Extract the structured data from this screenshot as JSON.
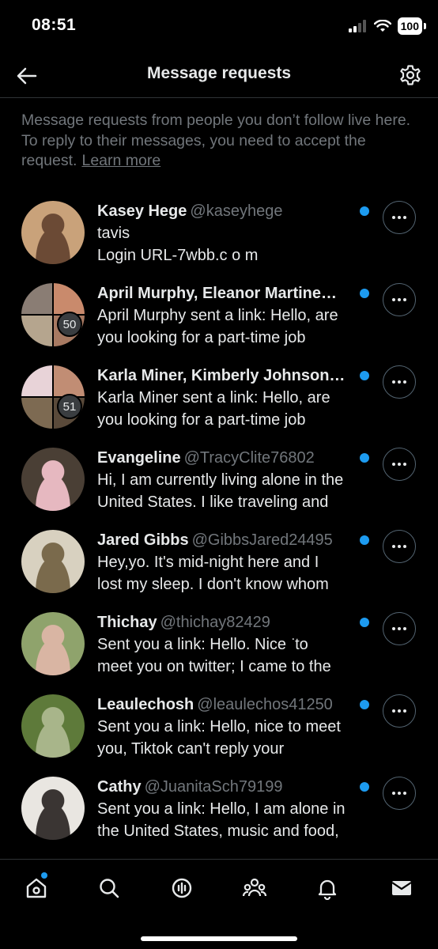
{
  "status_bar": {
    "time": "08:51",
    "battery": "100"
  },
  "header": {
    "title": "Message requests"
  },
  "info": {
    "text": "Message requests from people you don’t follow live here. To reply to their messages, you need to accept the request.",
    "link": "Learn more"
  },
  "requests": [
    {
      "name": "Kasey Hege",
      "handle": "@kaseyhege",
      "lines": [
        "tavis",
        "Login URL-7wbb.c o m"
      ],
      "avatar_colors": [
        "#c9a27a",
        "#6b4a35"
      ]
    },
    {
      "name": "April Murphy, Eleanor Martine…",
      "handle": "",
      "lines": [
        "April Murphy sent a link: Hello, are",
        "you looking for a part-time job"
      ],
      "group_count": "50",
      "avatar_colors": [
        "#8a7d74",
        "#c98a6c",
        "#b5a58e",
        "#a87a62"
      ]
    },
    {
      "name": "Karla Miner, Kimberly Johnson…",
      "handle": "",
      "lines": [
        "Karla Miner sent a link: Hello, are",
        "you looking for a part-time job"
      ],
      "group_count": "51",
      "avatar_colors": [
        "#e8d3d8",
        "#c18d74",
        "#7d6a52",
        "#5a4a3a"
      ]
    },
    {
      "name": "Evangeline",
      "handle": "@TracyClite76802",
      "lines": [
        "Hi, I am currently living alone in the",
        "United States. I like traveling and"
      ],
      "avatar_colors": [
        "#4a3f35",
        "#e6b8c0"
      ]
    },
    {
      "name": "Jared Gibbs",
      "handle": "@GibbsJared24495",
      "lines": [
        "Hey,yo. It's mid-night here and I",
        "lost my sleep. I don't know whom"
      ],
      "avatar_colors": [
        "#d8d1c0",
        "#7a6a4c"
      ]
    },
    {
      "name": "Thichay",
      "handle": "@thichay82429",
      "lines": [
        "Sent you a link: Hello. Nice ͘ to",
        "meet you on twitter; I came ͏to ͘the"
      ],
      "avatar_colors": [
        "#8fa36c",
        "#d9b5a3"
      ]
    },
    {
      "name": "Leaulechosh",
      "handle": "@leaulechos41250",
      "lines": [
        "Sent you a link: Hello, nice to meet",
        "you, Tiktok can't reply your"
      ],
      "avatar_colors": [
        "#5e7a3a",
        "#a8b58a"
      ]
    },
    {
      "name": "Cathy",
      "handle": "@JuanitaSch79199",
      "lines": [
        "Sent you a link: Hello, I am alone in",
        "the United States, music and food,"
      ],
      "avatar_colors": [
        "#e9e6e1",
        "#3a3533"
      ]
    }
  ],
  "icons": {
    "back": "back-arrow-icon",
    "settings": "gear-icon",
    "more": "more-horizontal-icon",
    "tabs": [
      "home-icon",
      "search-icon",
      "spaces-icon",
      "communities-icon",
      "notifications-icon",
      "messages-icon"
    ]
  },
  "colors": {
    "accent": "#1d9bf0",
    "background": "#000000",
    "text": "#e7e9ea",
    "secondary_text": "#71767b"
  }
}
